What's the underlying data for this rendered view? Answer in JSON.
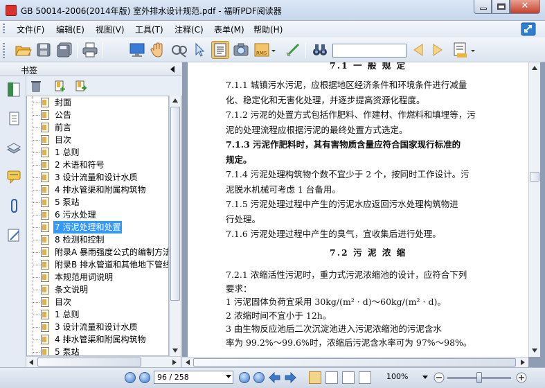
{
  "window": {
    "title": "GB 50014-2006(2014年版) 室外排水设计规范.pdf - 福昕PDF阅读器"
  },
  "menu": [
    "文件(F)",
    "编辑(E)",
    "视图(V)",
    "工具(T)",
    "注释(C)",
    "表单(M)",
    "帮助(H)"
  ],
  "toolbar": {
    "search_value": "",
    "buttons": [
      "open-icon",
      "save-icon",
      "save-all-icon",
      "print-icon",
      "screen-icon",
      "hand-icon",
      "zoom-glass-icon",
      "select-arrow-icon",
      "text-select-icon",
      "snapshot-icon",
      "rms-icon",
      "sign-icon",
      "binoculars-icon",
      "prev-result-icon",
      "next-result-icon",
      "highlight-icon"
    ],
    "rms_label": "RMS"
  },
  "bookmarks": {
    "title": "书签",
    "items": [
      "封面",
      "公告",
      "前言",
      "目次",
      "1 总则",
      "2 术语和符号",
      "3 设计流量和设计水质",
      "4 排水管渠和附属构筑物",
      "5 泵站",
      "6 污水处理",
      "7 污泥处理和处置",
      "8 检测和控制",
      "附录A 暴雨强度公式的编制方法",
      "附录B 排水管道和其他地下管线",
      "本规范用词说明",
      "条文说明",
      "目次",
      "1 总则",
      "3 设计流量和设计水质",
      "4 排水管渠和附属构筑物",
      "5 泵站"
    ],
    "selected_index": 10
  },
  "document": {
    "top_heading": "7.1  一 般 规 定",
    "lines": [
      "7.1.1   城镇污水污泥，应根据地区经济条件和环境条件进行减量",
      "化、稳定化和无害化处理，并逐步提高资源化程度。",
      "7.1.2   污泥的处置方式包括作肥料、作建材、作燃料和填埋等，污",
      "泥的处理流程应根据污泥的最终处置方式选定。",
      "7.1.3   污泥作肥料时，其有害物质含量应符合国家现行标准的",
      "规定。",
      "7.1.4   污泥处理构筑物个数不宜少于 2 个，按同时工作设计。污",
      "泥脱水机械可考虑 1 台备用。",
      "7.1.5   污泥处理过程中产生的污泥水应返回污水处理构筑物进",
      "行处理。",
      "7.1.6   污泥处理过程中产生的臭气，宜收集后进行处理。"
    ],
    "heading2": "7.2  污 泥 浓 缩",
    "lines2": [
      "7.2.1   浓缩活性污泥时，重力式污泥浓缩池的设计，应符合下列",
      "要求：",
      "    1   污泥固体负荷宜采用 30kg/(m² · d)～60kg/(m² · d)。",
      "    2   浓缩时间不宜小于 12h。",
      "    3   由生物反应池后二次沉淀池进入污泥浓缩池的污泥含水",
      "率为 99.2%～99.6%时，浓缩后污泥含水率可为 97%～98%。"
    ]
  },
  "status": {
    "page_display": "96 / 258",
    "zoom": "100%"
  }
}
